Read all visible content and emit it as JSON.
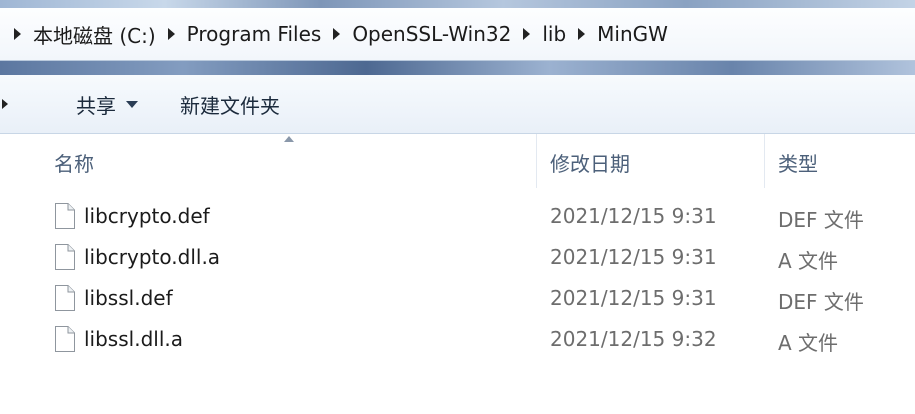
{
  "address_bar": {
    "crumbs": [
      "本地磁盘 (C:)",
      "Program Files",
      "OpenSSL-Win32",
      "lib",
      "MinGW"
    ]
  },
  "toolbar": {
    "share_label": "共享",
    "new_folder_label": "新建文件夹"
  },
  "columns": {
    "name": "名称",
    "date_modified": "修改日期",
    "type": "类型"
  },
  "files": [
    {
      "name": "libcrypto.def",
      "date": "2021/12/15 9:31",
      "type": "DEF 文件",
      "icon": "file-icon"
    },
    {
      "name": "libcrypto.dll.a",
      "date": "2021/12/15 9:31",
      "type": "A 文件",
      "icon": "file-icon"
    },
    {
      "name": "libssl.def",
      "date": "2021/12/15 9:31",
      "type": "DEF 文件",
      "icon": "file-icon"
    },
    {
      "name": "libssl.dll.a",
      "date": "2021/12/15 9:32",
      "type": "A 文件",
      "icon": "file-icon"
    }
  ]
}
